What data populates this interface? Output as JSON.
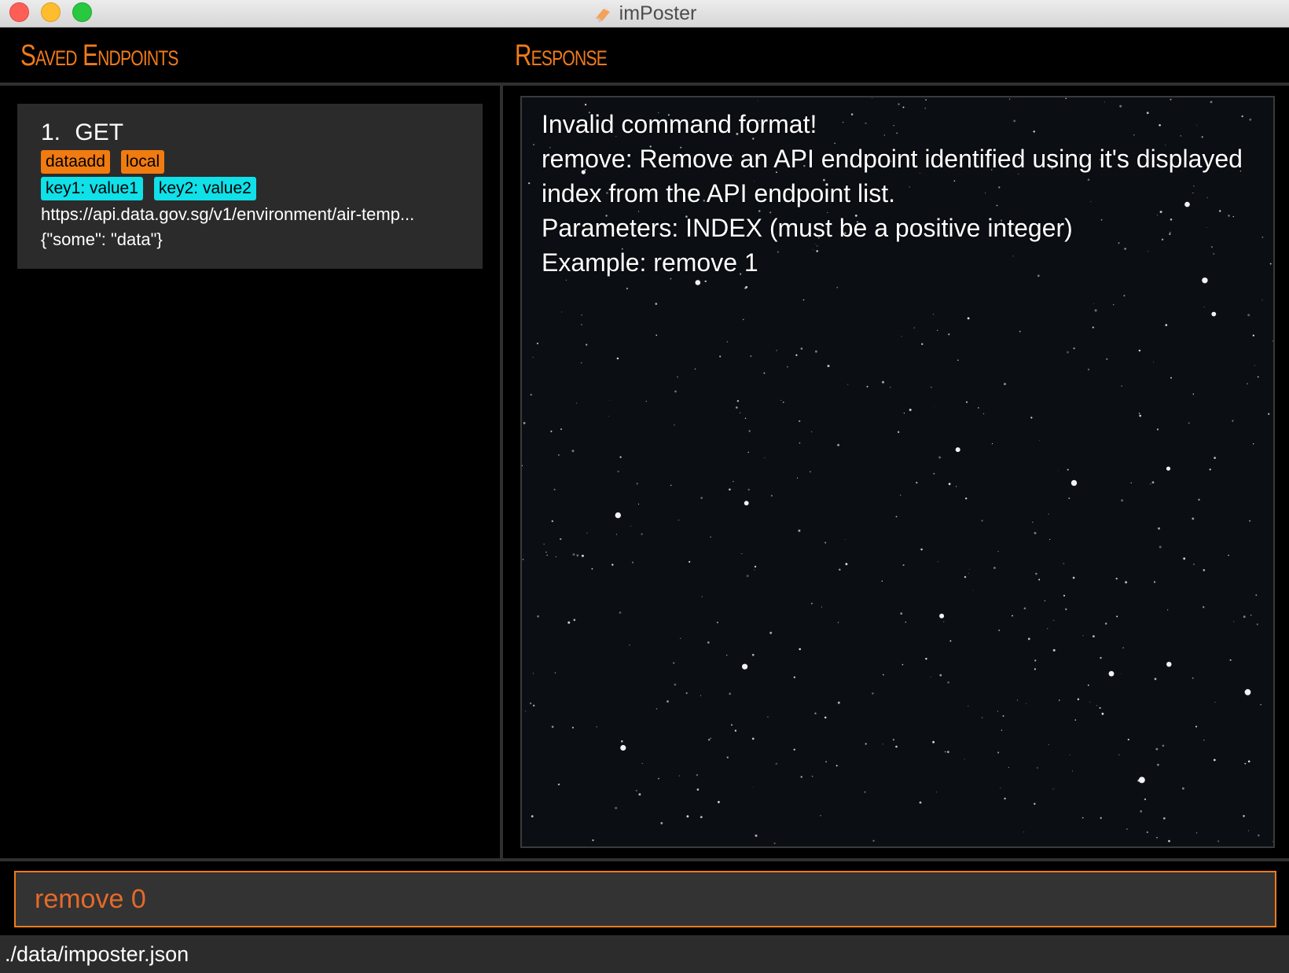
{
  "window": {
    "title": "imPoster"
  },
  "endpoints_panel": {
    "header": "Saved Endpoints",
    "items": [
      {
        "index": "1.",
        "method": "GET",
        "tags": [
          "dataadd",
          "local"
        ],
        "headers": [
          "key1: value1",
          "key2: value2"
        ],
        "url": "https://api.data.gov.sg/v1/environment/air-temp...",
        "data": "{\"some\": \"data\"}"
      }
    ]
  },
  "response_panel": {
    "header": "Response",
    "lines": [
      "Invalid command format!",
      "remove: Remove an API endpoint identified using it's displayed",
      "index from the API endpoint list.",
      "Parameters: INDEX (must be a positive integer)",
      "Example: remove 1"
    ]
  },
  "command_box": {
    "value": "remove 0"
  },
  "status_bar": {
    "path": "./data/imposter.json"
  },
  "colors": {
    "accent": "#f07b1a",
    "tag_orange": "#f07b10",
    "tag_cyan": "#10e0e8",
    "card_bg": "#2b2b2b",
    "command_text": "#e56a2a"
  }
}
